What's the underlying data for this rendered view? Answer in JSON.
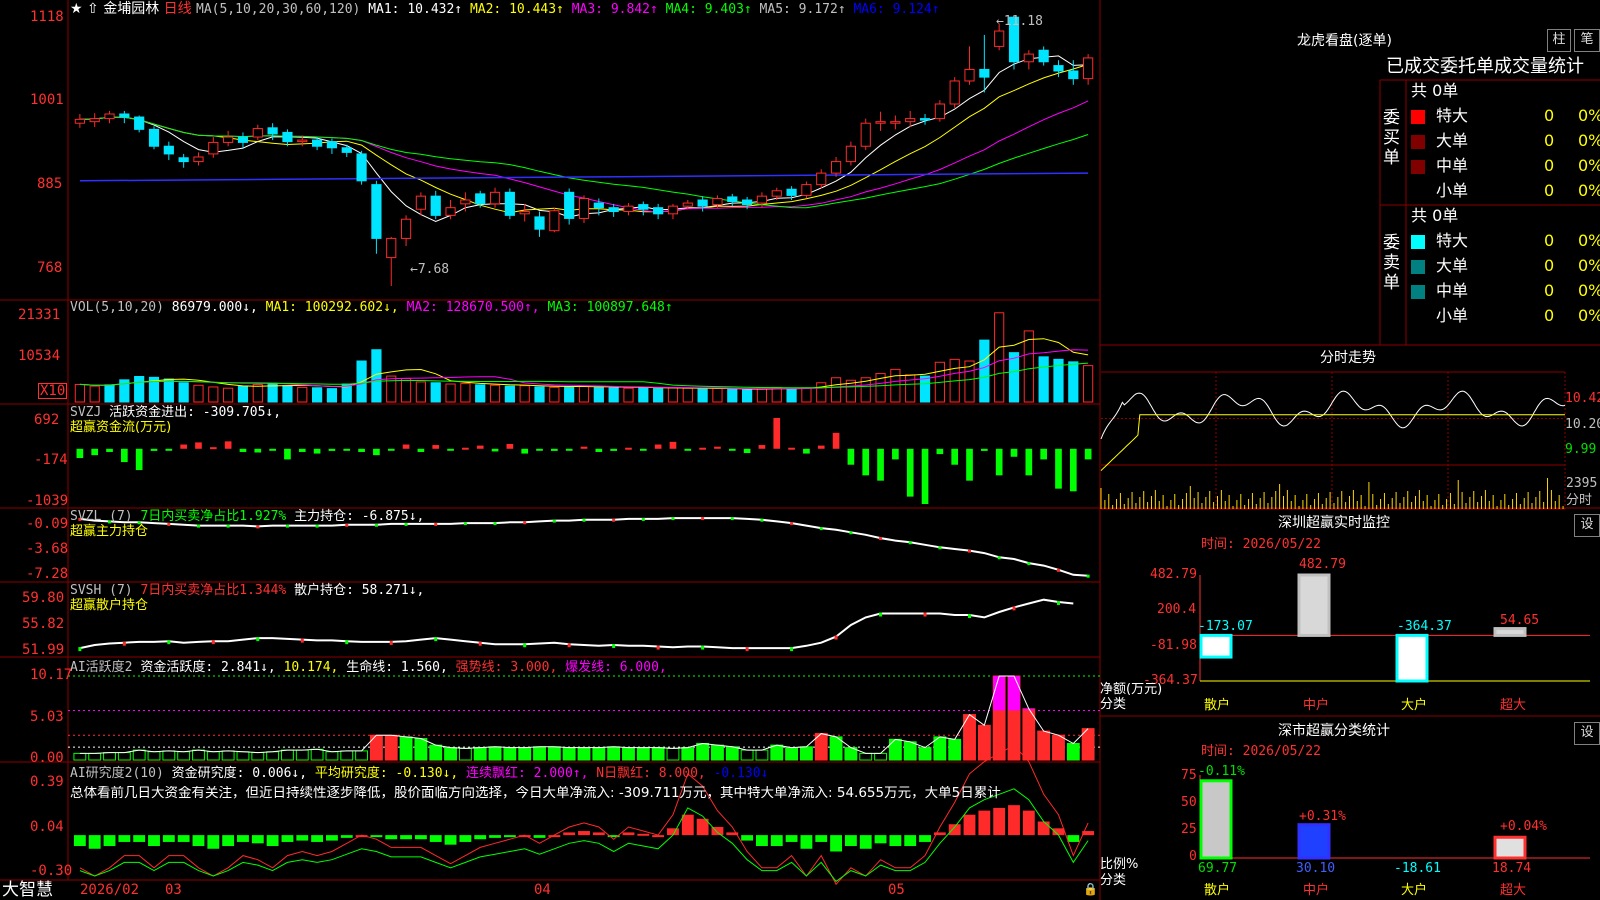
{
  "stock_name": "金埔园林",
  "period": "日线",
  "bottom_left_label": "大智慧",
  "x_axis_labels": {
    "feb": "2026/02",
    "mar": "03",
    "apr": "04",
    "may": "05"
  },
  "colors": {
    "up": "#ff2a2a",
    "down": "#00e5ff",
    "ma1": "#ffffff",
    "ma2": "#ffff00",
    "ma3": "#ff00ff",
    "ma4": "#00ff00",
    "ma5": "#0000ff",
    "ma6": "#c0c0c0"
  },
  "panels": {
    "price": {
      "header": {
        "ma_params": "MA(5,10,20,30,60,120)",
        "ma1": "MA1: 10.432↑",
        "ma2": "MA2: 10.443↑",
        "ma3": "MA3: 9.842↑",
        "ma4": "MA4: 9.403↑",
        "ma5": "MA5: 9.172↑",
        "ma6": "MA6: 9.124↑"
      },
      "y_ticks": [
        "1118",
        "1001",
        "885",
        "768"
      ],
      "high_label": "←11.18",
      "low_label": "←7.68"
    },
    "vol": {
      "header": {
        "params": "VOL(5,10,20)",
        "value": "86979.000↓,",
        "ma1": "MA1: 100292.602↓,",
        "ma2": "MA2: 128670.500↑,",
        "ma3": "MA3: 100897.648↑"
      },
      "y_ticks": [
        "21331",
        "10534"
      ],
      "unit": "X10"
    },
    "svzj": {
      "header": {
        "name": "SVZJ",
        "text": "活跃资金进出: -309.705↓,",
        "subtitle": "超赢资金流(万元)"
      },
      "y_ticks": [
        "692",
        "-174",
        "-1039"
      ]
    },
    "svzl": {
      "header": {
        "name": "SVZL (7)",
        "ratio": "7日内买卖净占比1.927%",
        "hold": "主力持仓: -6.875↓,",
        "subtitle": "超赢主力持仓"
      },
      "y_ticks": [
        "-0.09",
        "-3.68",
        "-7.28"
      ]
    },
    "svsh": {
      "header": {
        "name": "SVSH (7)",
        "ratio": "7日内买卖净占比1.344%",
        "hold": "散户持仓: 58.271↓,",
        "subtitle": "超赢散户持仓"
      },
      "y_ticks": [
        "59.80",
        "55.82",
        "51.99"
      ]
    },
    "ai1": {
      "header": {
        "name": "AI活跃度2",
        "a": "资金活跃度: 2.841↓,",
        "b": "10.174,",
        "c": "生命线: 1.560,",
        "d": "强势线: 3.000,",
        "e": "爆发线: 6.000,"
      },
      "y_ticks": [
        "10.17",
        "5.03",
        "0.00"
      ]
    },
    "ai2": {
      "header": {
        "name": "AI研究度2(10)",
        "a": "资金研究度: 0.006↓,",
        "b": "平均研究度: -0.130↓,",
        "c": "连续飘红: 2.000↑,",
        "d": "N日飘红: 8.000,",
        "e": "-0.130↓"
      },
      "comment": "总体看前几日大资金有关注，但近日持续性逐步降低，股价面临方向选择，今日大单净流入: -309.711万元，其中特大单净流入: 54.655万元，大单5日累计",
      "y_ticks": [
        "0.39",
        "0.04",
        "-0.30"
      ]
    }
  },
  "right": {
    "longhu": {
      "title": "龙虎看盘(逐单)",
      "tab_zhu": "柱",
      "tab_bi": "笔",
      "subtitle": "已成交委托单成交量统计",
      "buy": {
        "side": "委买单",
        "total": "共 0单",
        "rows": [
          {
            "label": "特大",
            "val": "0",
            "pct": "0%"
          },
          {
            "label": "大单",
            "val": "0",
            "pct": "0%"
          },
          {
            "label": "中单",
            "val": "0",
            "pct": "0%"
          },
          {
            "label": "小单",
            "val": "0",
            "pct": "0%"
          }
        ]
      },
      "sell": {
        "side": "委卖单",
        "total": "共 0单",
        "rows": [
          {
            "label": "特大",
            "val": "0",
            "pct": "0%"
          },
          {
            "label": "大单",
            "val": "0",
            "pct": "0%"
          },
          {
            "label": "中单",
            "val": "0",
            "pct": "0%"
          },
          {
            "label": "小单",
            "val": "0",
            "pct": "0%"
          }
        ]
      }
    },
    "fenshi": {
      "title": "分时走势",
      "y_ticks": [
        "10.42",
        "10.20",
        "9.99"
      ],
      "vol_label": "2395",
      "vol_label2": "分时"
    },
    "szrt": {
      "title": "深圳超赢实时监控",
      "setting": "设",
      "time": "时间: 2026/05/22",
      "y_ticks": [
        "482.79",
        "200.4",
        "-81.98",
        "-364.37"
      ],
      "ylabel": "净额(万元)",
      "xlabel": "分类",
      "categories": [
        "散户",
        "中户",
        "大户",
        "超大"
      ],
      "values": [
        -173.07,
        482.79,
        -364.37,
        54.65
      ],
      "value_labels": [
        "-173.07",
        "482.79",
        "-364.37",
        "54.65"
      ]
    },
    "szcls": {
      "title": "深市超赢分类统计",
      "setting": "设",
      "time": "时间: 2026/05/22",
      "y_ticks": [
        "75",
        "50",
        "25",
        "0"
      ],
      "ylabel": "比例%",
      "xlabel": "分类",
      "categories": [
        "散户",
        "中户",
        "大户",
        "超大"
      ],
      "values": [
        69.77,
        30.1,
        -18.61,
        18.74
      ],
      "changes": [
        "-0.11%",
        "+0.31%",
        "",
        "+0.04%"
      ]
    }
  },
  "chart_data": [
    {
      "type": "candlestick",
      "title": "金埔园林 日线",
      "dates": [
        "2026/02",
        "",
        "",
        "",
        "",
        "",
        "",
        "",
        "",
        "",
        "",
        "",
        "",
        "",
        "",
        "03",
        "",
        "",
        "",
        "",
        "",
        "",
        "",
        "",
        "",
        "",
        "",
        "",
        "",
        "",
        "",
        "",
        "",
        "",
        "",
        "",
        "04",
        "",
        "",
        "",
        "",
        "",
        "",
        "",
        "",
        "",
        "",
        "",
        "",
        "",
        "",
        "",
        "",
        "",
        "",
        "",
        "05",
        "",
        "",
        "",
        "",
        "",
        "",
        "",
        "",
        "",
        "",
        "",
        "",
        ""
      ],
      "candles": [
        [
          9.8,
          9.85,
          9.74,
          9.92
        ],
        [
          9.82,
          9.86,
          9.75,
          9.93
        ],
        [
          9.86,
          9.92,
          9.8,
          9.96
        ],
        [
          9.92,
          9.88,
          9.8,
          9.96
        ],
        [
          9.88,
          9.72,
          9.68,
          9.9
        ],
        [
          9.72,
          9.5,
          9.46,
          9.76
        ],
        [
          9.5,
          9.4,
          9.32,
          9.56
        ],
        [
          9.35,
          9.3,
          9.22,
          9.4
        ],
        [
          9.3,
          9.36,
          9.25,
          9.42
        ],
        [
          9.4,
          9.55,
          9.35,
          9.62
        ],
        [
          9.55,
          9.62,
          9.5,
          9.7
        ],
        [
          9.62,
          9.55,
          9.48,
          9.68
        ],
        [
          9.62,
          9.73,
          9.58,
          9.78
        ],
        [
          9.74,
          9.66,
          9.58,
          9.8
        ],
        [
          9.68,
          9.56,
          9.5,
          9.72
        ],
        [
          9.56,
          9.58,
          9.5,
          9.64
        ],
        [
          9.58,
          9.5,
          9.45,
          9.62
        ],
        [
          9.56,
          9.48,
          9.4,
          9.6
        ],
        [
          9.48,
          9.42,
          9.36,
          9.52
        ],
        [
          9.4,
          9.05,
          9.0,
          9.44
        ],
        [
          9.0,
          8.3,
          8.1,
          9.05
        ],
        [
          8.05,
          8.3,
          7.68,
          8.32
        ],
        [
          8.3,
          8.55,
          8.2,
          8.6
        ],
        [
          8.68,
          8.85,
          8.6,
          8.9
        ],
        [
          8.85,
          8.6,
          8.55,
          8.92
        ],
        [
          8.6,
          8.7,
          8.55,
          8.8
        ],
        [
          8.75,
          8.8,
          8.65,
          8.9
        ],
        [
          8.88,
          8.75,
          8.7,
          8.92
        ],
        [
          8.75,
          8.9,
          8.7,
          8.96
        ],
        [
          8.9,
          8.6,
          8.55,
          8.95
        ],
        [
          8.62,
          8.65,
          8.52,
          8.75
        ],
        [
          8.58,
          8.42,
          8.32,
          8.65
        ],
        [
          8.4,
          8.66,
          8.38,
          8.7
        ],
        [
          8.9,
          8.56,
          8.48,
          8.95
        ],
        [
          8.56,
          8.82,
          8.5,
          8.86
        ],
        [
          8.76,
          8.7,
          8.6,
          8.82
        ],
        [
          8.7,
          8.65,
          8.58,
          8.75
        ],
        [
          8.65,
          8.72,
          8.6,
          8.76
        ],
        [
          8.74,
          8.68,
          8.6,
          8.78
        ],
        [
          8.7,
          8.62,
          8.55,
          8.75
        ],
        [
          8.62,
          8.72,
          8.55,
          8.75
        ],
        [
          8.72,
          8.76,
          8.68,
          8.8
        ],
        [
          8.8,
          8.72,
          8.65,
          8.85
        ],
        [
          8.74,
          8.82,
          8.7,
          8.86
        ],
        [
          8.84,
          8.78,
          8.72,
          8.88
        ],
        [
          8.8,
          8.74,
          8.68,
          8.84
        ],
        [
          8.76,
          8.85,
          8.7,
          8.9
        ],
        [
          8.85,
          8.92,
          8.8,
          8.96
        ],
        [
          8.94,
          8.86,
          8.8,
          8.98
        ],
        [
          8.86,
          9.0,
          8.82,
          9.04
        ],
        [
          9.0,
          9.15,
          8.95,
          9.2
        ],
        [
          9.15,
          9.3,
          9.1,
          9.36
        ],
        [
          9.3,
          9.5,
          9.25,
          9.56
        ],
        [
          9.5,
          9.8,
          9.45,
          9.86
        ],
        [
          9.8,
          9.82,
          9.7,
          9.95
        ],
        [
          9.8,
          9.82,
          9.72,
          9.9
        ],
        [
          9.82,
          9.86,
          9.75,
          9.96
        ],
        [
          9.86,
          9.84,
          9.78,
          9.92
        ],
        [
          9.86,
          10.05,
          9.82,
          10.1
        ],
        [
          10.05,
          10.35,
          10.0,
          10.4
        ],
        [
          10.35,
          10.5,
          10.3,
          10.8
        ],
        [
          10.5,
          10.4,
          10.2,
          10.95
        ],
        [
          10.8,
          11.0,
          10.75,
          11.1
        ],
        [
          11.18,
          10.6,
          10.5,
          11.18
        ],
        [
          10.6,
          10.7,
          10.5,
          10.75
        ],
        [
          10.75,
          10.6,
          10.55,
          10.8
        ],
        [
          10.55,
          10.48,
          10.4,
          10.62
        ],
        [
          10.48,
          10.38,
          10.3,
          10.62
        ],
        [
          10.38,
          10.65,
          10.3,
          10.7
        ]
      ]
    },
    {
      "type": "bar",
      "title": "VOL(5,10,20)",
      "unit": "X10",
      "values": [
        4200,
        3800,
        4100,
        5300,
        6100,
        5900,
        5500,
        4600,
        4000,
        3600,
        3300,
        3700,
        4200,
        4500,
        3900,
        3500,
        3400,
        3200,
        4300,
        9800,
        12500,
        6200,
        5600,
        4800,
        4600,
        4300,
        4400,
        4100,
        4000,
        3800,
        3900,
        3600,
        3500,
        3700,
        3800,
        3600,
        3400,
        3300,
        3500,
        3200,
        3400,
        3300,
        3100,
        3300,
        3000,
        2900,
        3100,
        3500,
        3300,
        3400,
        4600,
        5800,
        5200,
        5800,
        6800,
        7800,
        6500,
        6200,
        9500,
        10200,
        9800,
        14800,
        21331,
        11800,
        17000,
        10800,
        10200,
        9600,
        8697
      ],
      "updown": [
        1,
        1,
        0,
        0,
        0,
        0,
        0,
        0,
        1,
        1,
        1,
        0,
        1,
        0,
        0,
        1,
        0,
        0,
        0,
        0,
        0,
        1,
        1,
        1,
        0,
        1,
        1,
        0,
        1,
        0,
        1,
        0,
        1,
        0,
        1,
        0,
        0,
        1,
        0,
        0,
        1,
        1,
        0,
        1,
        0,
        0,
        1,
        1,
        0,
        1,
        1,
        1,
        1,
        1,
        1,
        1,
        1,
        0,
        1,
        1,
        1,
        0,
        1,
        0,
        1,
        0,
        0,
        0,
        1
      ]
    },
    {
      "type": "bar",
      "title": "超赢资金流(万元)",
      "values": [
        -174,
        -120,
        -60,
        -250,
        -400,
        -40,
        -30,
        80,
        120,
        30,
        140,
        -60,
        -70,
        -20,
        -200,
        -60,
        -90,
        -40,
        -10,
        -60,
        -120,
        -20,
        80,
        -60,
        70,
        -20,
        20,
        60,
        -50,
        90,
        -90,
        -10,
        -40,
        -20,
        40,
        -60,
        -40,
        20,
        -30,
        80,
        130,
        -30,
        20,
        40,
        -20,
        -80,
        70,
        580,
        20,
        -90,
        60,
        300,
        -300,
        -500,
        -600,
        -200,
        -900,
        -1039,
        -100,
        -300,
        -600,
        -40,
        -500,
        -150,
        -500,
        -200,
        -750,
        -800,
        -200,
        -1000,
        -150,
        -500
      ],
      "ylim": [
        -1039,
        692
      ]
    },
    {
      "type": "line",
      "title": "超赢主力持仓",
      "values": [
        -0.2,
        -0.4,
        -0.5,
        -0.6,
        -0.6,
        -0.7,
        -0.8,
        -0.9,
        -1.0,
        -1.0,
        -1.0,
        -1.0,
        -1.1,
        -1.0,
        -1.0,
        -1.0,
        -1.0,
        -1.0,
        -0.9,
        -0.9,
        -0.9,
        -0.8,
        -0.8,
        -0.8,
        -0.8,
        -0.8,
        -0.7,
        -0.7,
        -0.7,
        -0.6,
        -0.6,
        -0.5,
        -0.4,
        -0.4,
        -0.3,
        -0.3,
        -0.3,
        -0.2,
        -0.2,
        -0.2,
        -0.1,
        -0.1,
        -0.1,
        -0.1,
        -0.1,
        -0.2,
        -0.3,
        -0.5,
        -0.7,
        -1.0,
        -1.3,
        -1.5,
        -1.8,
        -2.1,
        -2.5,
        -2.8,
        -3.0,
        -3.3,
        -3.6,
        -3.8,
        -4.0,
        -4.3,
        -4.8,
        -5.0,
        -5.5,
        -5.8,
        -6.3,
        -6.9,
        -7.0
      ],
      "ylim": [
        -7.28,
        -0.09
      ]
    },
    {
      "type": "line",
      "title": "超赢散户持仓",
      "values": [
        52.5,
        52.9,
        53.1,
        53.2,
        53.3,
        53.3,
        53.4,
        53.2,
        53.3,
        53.4,
        53.4,
        53.6,
        53.8,
        53.8,
        53.7,
        53.6,
        53.5,
        53.5,
        53.4,
        53.3,
        53.3,
        53.3,
        53.4,
        53.6,
        53.8,
        53.6,
        53.4,
        53.2,
        53.0,
        53.0,
        53.0,
        53.1,
        53.2,
        53.0,
        52.9,
        52.8,
        52.9,
        52.8,
        52.8,
        52.7,
        52.6,
        52.7,
        52.7,
        52.6,
        52.5,
        52.5,
        52.5,
        52.5,
        52.5,
        52.8,
        53.2,
        54.0,
        55.5,
        56.5,
        57.0,
        57.0,
        57.0,
        57.0,
        57.0,
        56.8,
        56.8,
        56.5,
        57.2,
        57.8,
        58.3,
        58.8,
        58.5,
        58.3
      ],
      "ylim": [
        51.99,
        59.8
      ]
    },
    {
      "type": "bar",
      "title": "AI活跃度2",
      "values": [
        0.8,
        0.8,
        0.9,
        0.9,
        1.2,
        1.0,
        1.1,
        1.0,
        1.2,
        1.0,
        1.1,
        1.0,
        0.9,
        1.0,
        1.2,
        1.2,
        1.3,
        1.0,
        1.1,
        1.1,
        3.0,
        3.0,
        2.8,
        2.6,
        1.8,
        1.5,
        1.4,
        1.5,
        1.6,
        1.5,
        1.5,
        1.6,
        1.6,
        1.5,
        1.5,
        1.5,
        1.6,
        1.5,
        1.5,
        1.5,
        1.4,
        1.5,
        2.0,
        1.8,
        1.6,
        1.2,
        1.2,
        1.8,
        1.5,
        1.6,
        3.2,
        2.8,
        1.5,
        0.8,
        0.8,
        2.5,
        2.2,
        1.5,
        2.8,
        2.5,
        5.5,
        4.2,
        10.17,
        10.17,
        6.2,
        3.5,
        3.0,
        2.0,
        3.8,
        3.0,
        2.84
      ],
      "ylim": [
        0.0,
        10.17
      ]
    },
    {
      "type": "bar",
      "title": "AI研究度2(10)",
      "values": [
        -0.08,
        -0.1,
        -0.08,
        -0.05,
        -0.05,
        -0.08,
        -0.05,
        -0.05,
        -0.08,
        -0.1,
        -0.08,
        -0.05,
        -0.06,
        -0.08,
        -0.05,
        -0.04,
        -0.05,
        -0.04,
        -0.02,
        0.0,
        -0.01,
        -0.03,
        -0.03,
        -0.03,
        -0.05,
        -0.07,
        -0.05,
        -0.03,
        -0.02,
        -0.01,
        0.0,
        -0.02,
        0.0,
        0.02,
        0.03,
        0.02,
        -0.01,
        0.02,
        0.01,
        0.0,
        0.05,
        0.15,
        0.12,
        0.06,
        0.02,
        -0.04,
        -0.08,
        -0.08,
        -0.05,
        -0.1,
        -0.05,
        -0.12,
        -0.08,
        -0.1,
        -0.06,
        -0.08,
        -0.08,
        -0.05,
        0.02,
        0.08,
        0.15,
        0.18,
        0.2,
        0.22,
        0.18,
        0.1,
        0.05,
        -0.05,
        0.03,
        -0.05,
        0.006
      ],
      "ylim": [
        -0.3,
        0.39
      ]
    }
  ]
}
